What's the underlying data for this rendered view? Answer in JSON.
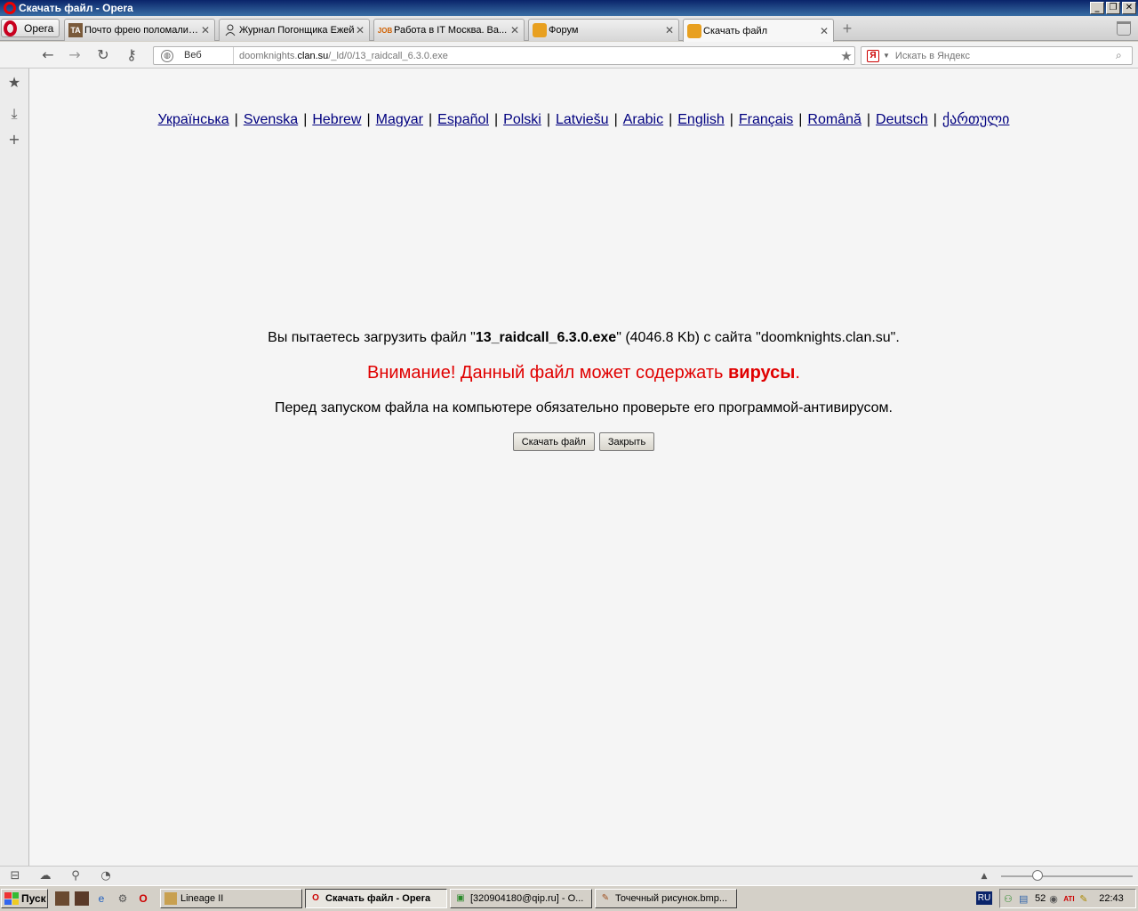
{
  "window": {
    "title": "Скачать файл - Opera",
    "controls": [
      "_",
      "❐",
      "✕"
    ]
  },
  "tabbar": {
    "menu_label": "Opera",
    "tabs": [
      {
        "label": "Почто фрею поломали?...",
        "favicon": "TA",
        "active": false
      },
      {
        "label": "Журнал Погонщика Ежей",
        "favicon": "user-icon",
        "active": false
      },
      {
        "label": "Работа в IT Москва. Ва...",
        "favicon": "job-icon",
        "active": false
      },
      {
        "label": "Форум",
        "favicon": "anime-icon",
        "active": false
      },
      {
        "label": "Скачать файл",
        "favicon": "anime-icon",
        "active": true
      }
    ]
  },
  "navbar": {
    "address_prefix_label": "Веб",
    "url_dim_start": "doomknights.",
    "url_host": "clan.su",
    "url_rest": "/_ld/0/13_raidcall_6.3.0.exe",
    "search_placeholder": "Искать в Яндекс",
    "search_engine_letter": "Я"
  },
  "page": {
    "languages": [
      "Українська",
      "Svenska",
      "Hebrew",
      "Magyar",
      "Español",
      "Polski",
      "Latviešu",
      "Arabic",
      "English",
      "Français",
      "Română",
      "Deutsch",
      "ქართული"
    ],
    "separator": "|",
    "message_before": "Вы пытаетесь загрузить файл \"",
    "file_name": "13_raidcall_6.3.0.exe",
    "message_after": "\" (4046.8 Kb) с сайта \"doomknights.clan.su\".",
    "warning_before": "Внимание! Данный файл может содержать ",
    "warning_bold": "вирусы",
    "warning_after": ".",
    "advice": "Перед запуском файла на компьютере обязательно проверьте его программой-антивирусом.",
    "download_button": "Скачать файл",
    "close_button": "Закрыть"
  },
  "taskbar": {
    "start_label": "Пуск",
    "tasks": [
      {
        "label": "Lineage II",
        "active": false
      },
      {
        "label": "Скачать файл - Opera",
        "active": true
      },
      {
        "label": "[320904180@qip.ru] - О...",
        "active": false
      },
      {
        "label": "Точечный рисунок.bmp...",
        "active": false
      }
    ],
    "language": "RU",
    "tray_number": "52",
    "clock": "22:43"
  },
  "colors": {
    "link": "#00007f",
    "warning": "#e00000",
    "titlebar_start": "#0a246a"
  }
}
